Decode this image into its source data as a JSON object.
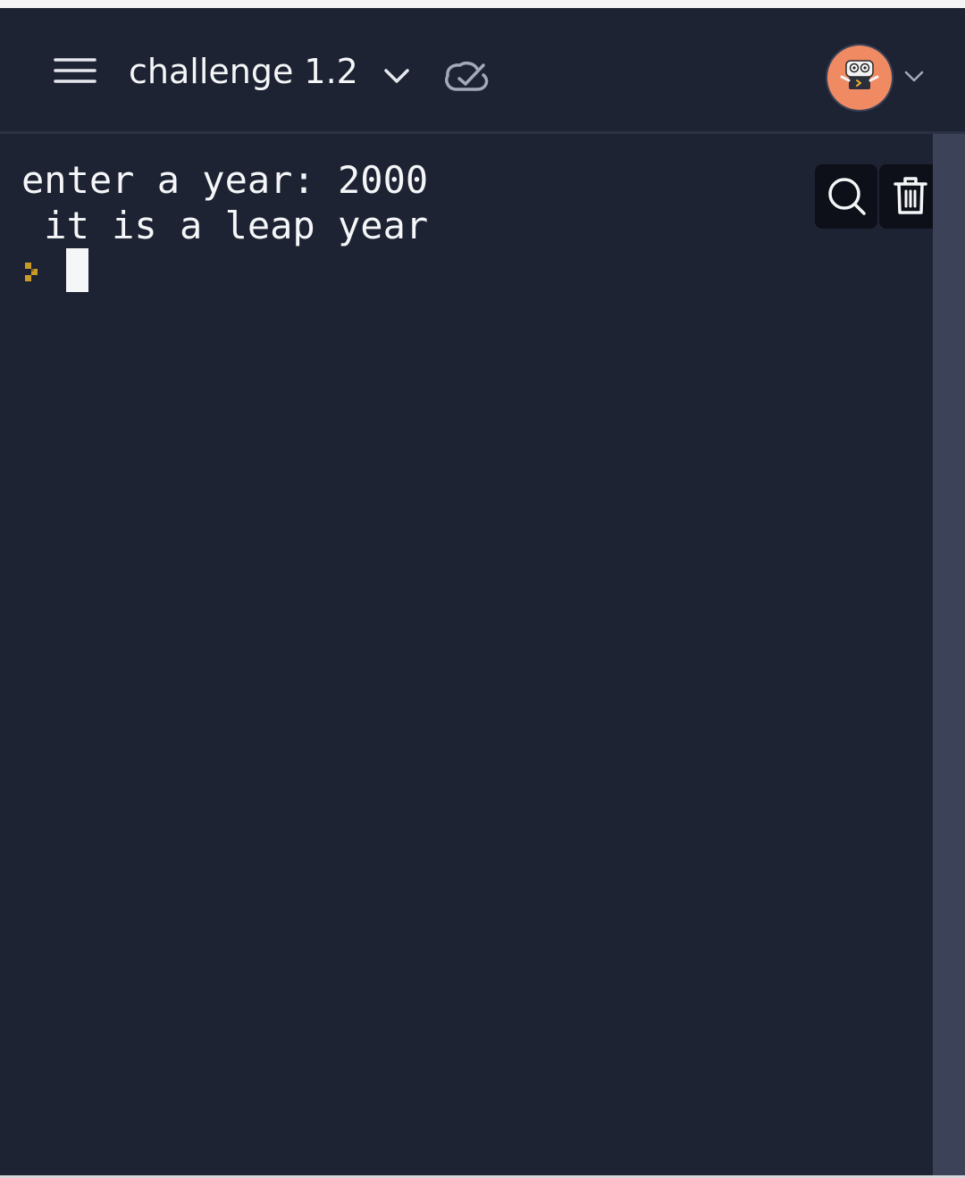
{
  "header": {
    "title": "challenge 1.2",
    "menu_icon": "hamburger-menu-icon",
    "title_dropdown_icon": "chevron-down-icon",
    "save_status_icon": "cloud-check-icon",
    "avatar_icon": "robot-avatar-icon",
    "avatar_dropdown_icon": "chevron-down-icon"
  },
  "console": {
    "lines": [
      "enter a year: 2000",
      " it is a leap year"
    ],
    "prompt_icon": "prompt-arrow-icon",
    "tools": {
      "search_icon": "search-icon",
      "clear_icon": "trash-icon"
    }
  },
  "colors": {
    "background": "#1d2333",
    "text": "#f5f6f8",
    "avatar": "#f08a62",
    "prompt": "#c99a28",
    "scrollbar": "#3c4359",
    "tool_button": "#0d1018"
  }
}
